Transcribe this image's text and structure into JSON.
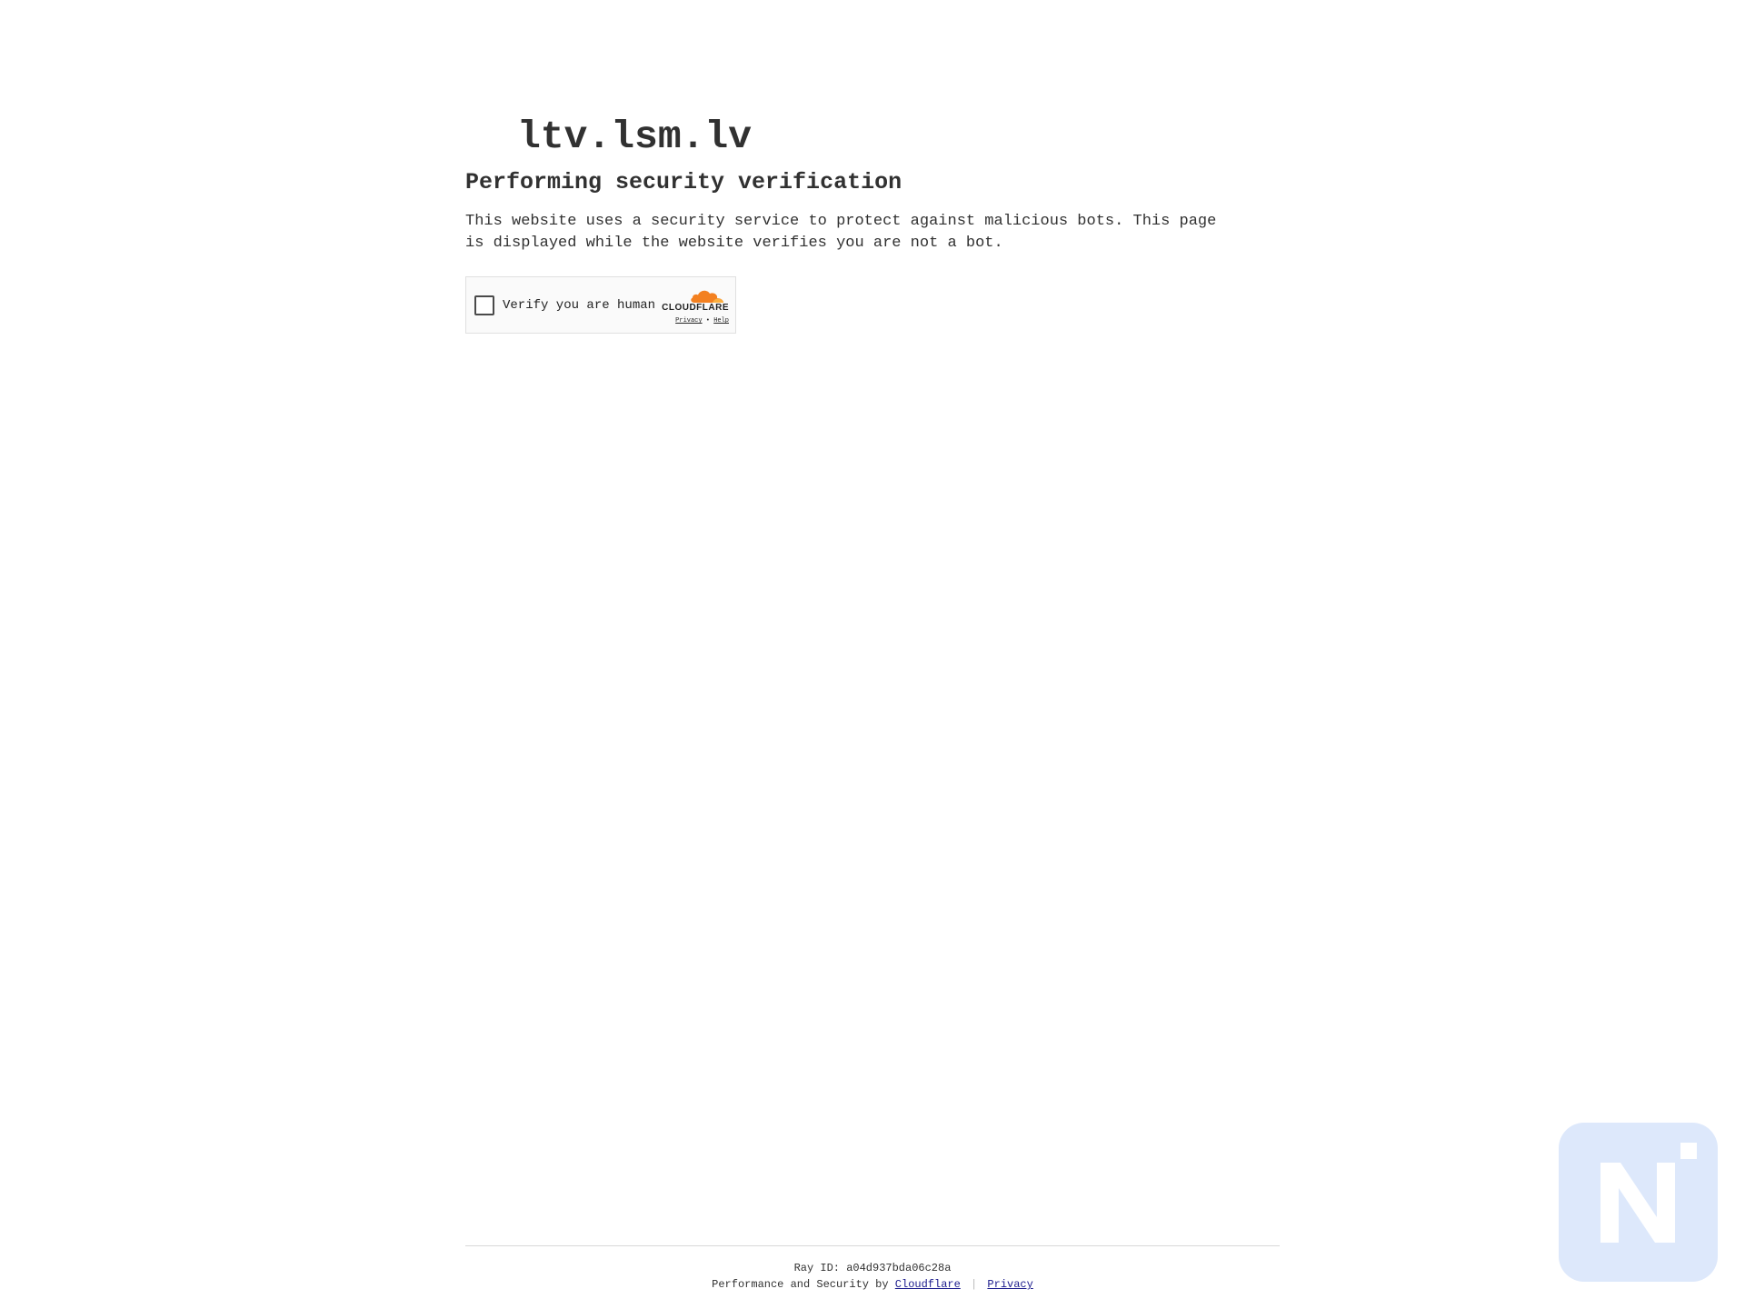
{
  "site": {
    "title": "ltv.lsm.lv"
  },
  "main": {
    "heading": "Performing security verification",
    "description": "This website uses a security service to protect against malicious bots. This page is displayed while the website verifies you are not a bot."
  },
  "widget": {
    "label": "Verify you are human",
    "brand": "CLOUDFLARE",
    "privacy_link": "Privacy",
    "separator": "•",
    "help_link": "Help",
    "checked": false,
    "brand_color": "#f38020"
  },
  "footer": {
    "ray_id": "Ray ID: a04d937bda06c28a",
    "perf_prefix": "Performance and Security by",
    "cloudflare_link": "Cloudflare",
    "separator": "|",
    "privacy_link": "Privacy"
  },
  "watermark": {
    "icon": "n-logo-icon",
    "color": "#dde8fb"
  }
}
